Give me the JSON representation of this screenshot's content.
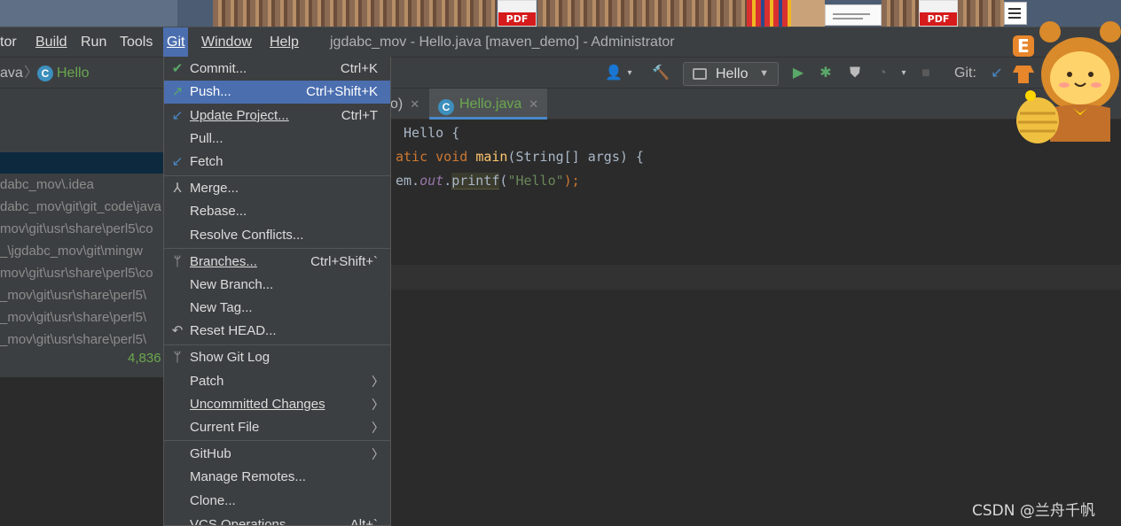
{
  "desktop": {
    "pdf_label_1": "PDF",
    "pdf_label_2": "PDF"
  },
  "menubar": {
    "items": [
      {
        "label": "tor"
      },
      {
        "label": "Build"
      },
      {
        "label": "Run"
      },
      {
        "label": "Tools"
      },
      {
        "label": "Git"
      },
      {
        "label": "Window"
      },
      {
        "label": "Help"
      }
    ],
    "window_title": "jgdabc_mov - Hello.java [maven_demo] - Administrator"
  },
  "navbar": {
    "crumb_prev": "ava",
    "crumb_class": "Hello",
    "run_config": "Hello",
    "git_label": "Git:"
  },
  "left_panel": {
    "rows": [
      "dabc_mov\\.idea",
      "dabc_mov\\git\\git_code\\java",
      "mov\\git\\usr\\share\\perl5\\co",
      "_\\jgdabc_mov\\git\\mingw",
      "mov\\git\\usr\\share\\perl5\\co",
      "_mov\\git\\usr\\share\\perl5\\",
      "_mov\\git\\usr\\share\\perl5\\",
      "_mov\\git\\usr\\share\\perl5\\"
    ],
    "count": "4,836"
  },
  "tabs": {
    "prev_tab_tail": "o)",
    "active_tab": "Hello.java"
  },
  "editor": {
    "line1_text": " Hello {",
    "line2_kw_a": "atic",
    "line2_kw_b": "void",
    "line2_fn": "main",
    "line2_rest": "(String[] args) {",
    "line3_pre": "em.",
    "line3_field": "out",
    "line3_dot": ".",
    "line3_method": "printf",
    "line3_open": "(",
    "line3_str": "\"Hello\"",
    "line3_close": ");"
  },
  "git_menu": {
    "items": [
      {
        "label": "Commit...",
        "shortcut": "Ctrl+K",
        "icon": "check-icon"
      },
      {
        "label": "Push...",
        "shortcut": "Ctrl+Shift+K",
        "icon": "push-arrow-icon"
      },
      {
        "label": "Update Project...",
        "shortcut": "Ctrl+T",
        "icon": "update-arrow-icon"
      },
      {
        "label": "Pull...",
        "shortcut": "",
        "icon": ""
      },
      {
        "label": "Fetch",
        "shortcut": "",
        "icon": "fetch-icon"
      },
      {
        "label": "Merge...",
        "shortcut": "",
        "icon": "merge-icon"
      },
      {
        "label": "Rebase...",
        "shortcut": "",
        "icon": ""
      },
      {
        "label": "Resolve Conflicts...",
        "shortcut": "",
        "icon": ""
      },
      {
        "label": "Branches...",
        "shortcut": "Ctrl+Shift+`",
        "icon": "branch-icon"
      },
      {
        "label": "New Branch...",
        "shortcut": "",
        "icon": ""
      },
      {
        "label": "New Tag...",
        "shortcut": "",
        "icon": ""
      },
      {
        "label": "Reset HEAD...",
        "shortcut": "",
        "icon": "undo-icon"
      },
      {
        "label": "Show Git Log",
        "shortcut": "",
        "icon": "branch-icon"
      },
      {
        "label": "Patch",
        "shortcut": "",
        "icon": ""
      },
      {
        "label": "Uncommitted Changes",
        "shortcut": "",
        "icon": ""
      },
      {
        "label": "Current File",
        "shortcut": "",
        "icon": ""
      },
      {
        "label": "GitHub",
        "shortcut": "",
        "icon": ""
      },
      {
        "label": "Manage Remotes...",
        "shortcut": "",
        "icon": ""
      },
      {
        "label": "Clone...",
        "shortcut": "",
        "icon": ""
      },
      {
        "label": "VCS Operations",
        "shortcut": "Alt+`",
        "icon": ""
      }
    ]
  },
  "mascot": {
    "badge_letter": "E"
  },
  "watermark": "CSDN @兰舟千帆"
}
